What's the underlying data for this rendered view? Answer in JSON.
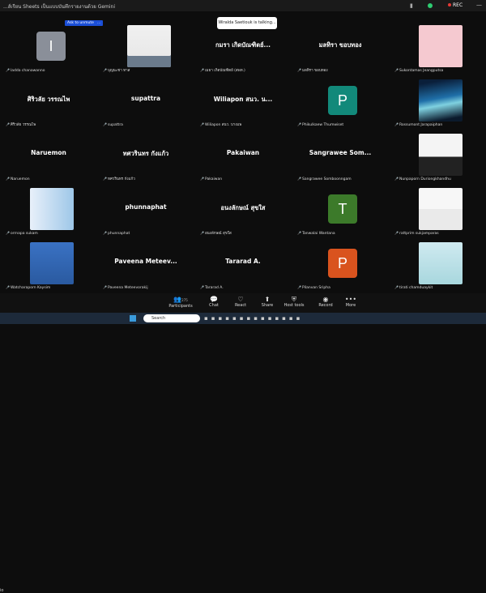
{
  "window": {
    "title": "...ส์เรียน Sheets เป็นแบบบันทึกรายงานด้วย Gemini",
    "rec_label": "REC"
  },
  "talking_indicator": "Wiralda Saetiouk is talking...",
  "pin_label": "Ask to unmute",
  "more_label": "...",
  "tiles": [
    {
      "name": "",
      "label": "ladda chanawanno",
      "avatar_letter": "I",
      "avatar_color": "#8a8f99"
    },
    {
      "name": "",
      "label": "บุญนะชา ทาส",
      "photo": "man-photo"
    },
    {
      "name": "กมรา เกิดบัณฑิตย์...",
      "label": "เมธา เกิดบัณฑิตย์ (สพท.)"
    },
    {
      "name": "มลทิรา ขอบทอง",
      "label": "มลทิรา ขอบทอง"
    },
    {
      "name": "",
      "label": "Sukontamas Jeangputsa",
      "photo": "cartoon-photo"
    },
    {
      "name": "ศิริวลัย วรรณไพ",
      "label": "ศิริวลัย วรรณไพ"
    },
    {
      "name": "supattra",
      "label": "supattra"
    },
    {
      "name": "Wiliapon สนว. น...",
      "label": "Wiliapon สนว. บางแพ"
    },
    {
      "name": "",
      "label": "Phikulkaew Thumwiset",
      "avatar_letter": "P",
      "avatar_color": "#12897a"
    },
    {
      "name": "",
      "label": "Rossumont Jarapaiphan",
      "photo": "aurora-photo"
    },
    {
      "name": "Naruemon",
      "label": "Naruemon"
    },
    {
      "name": "ทศวรินทร กังแก้ว",
      "label": "ทศวรินทร กังแก้ว"
    },
    {
      "name": "Pakaiwan",
      "label": "Pakaiwan"
    },
    {
      "name": "Sangrawee Som...",
      "label": "Sangrawee Somboonngam"
    },
    {
      "name": "",
      "label": "Nunpaporn Duriongkhandhu",
      "photo": "woman-photo"
    },
    {
      "name": "",
      "label": "orrnapa sukam",
      "photo": "banner-photo"
    },
    {
      "name": "phunnaphat",
      "label": "phunnaphat"
    },
    {
      "name": "อนงลักษณ์ สุขใส",
      "label": "อนงลักษณ์ สุขใส"
    },
    {
      "name": "",
      "label": "Tanwalai Wantana",
      "avatar_letter": "T",
      "avatar_color": "#3c7a2a"
    },
    {
      "name": "",
      "label": "rattprim sukjamparas",
      "photo": "uniform-photo"
    },
    {
      "name": "",
      "label": "Watcharaporn Kaysim",
      "photo": "woman2-photo"
    },
    {
      "name": "Paveena Meteev...",
      "label": "Paveena Meteevorakij"
    },
    {
      "name": "Tararad A.",
      "label": "Tararad A."
    },
    {
      "name": "",
      "label": "Pilanvan Sripha",
      "avatar_letter": "P",
      "avatar_color": "#d9531e"
    },
    {
      "name": "",
      "label": "tirati chamduaykit",
      "photo": "seal-photo"
    }
  ],
  "toolbar": {
    "participants": "Participants",
    "participants_count": "275",
    "chat": "Chat",
    "chat_badge": "1",
    "react": "React",
    "share": "Share",
    "host_tools": "Host tools",
    "record": "Record",
    "more": "More",
    "left_label": "io"
  },
  "taskbar": {
    "search_placeholder": "Search"
  },
  "colors": {
    "accent": "#1b4fd8",
    "muted_mic": "#e53935"
  }
}
